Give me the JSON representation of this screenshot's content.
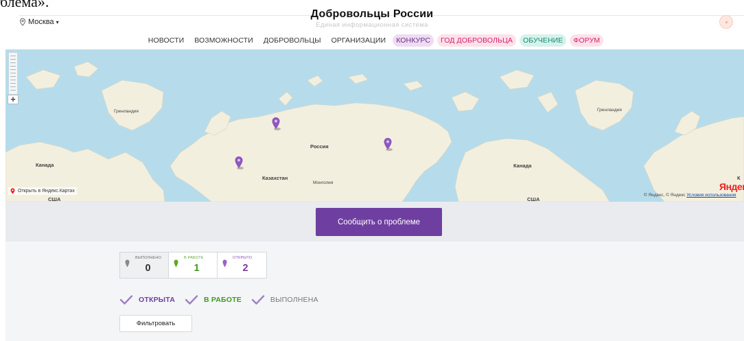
{
  "header": {
    "top_fragment": "блема».",
    "city": "Москва",
    "title": "Добровольцы России",
    "subtitle": "Единая информационная система"
  },
  "nav": {
    "items": [
      {
        "label": "НОВОСТИ"
      },
      {
        "label": "ВОЗМОЖНОСТИ"
      },
      {
        "label": "ДОБРОВОЛЬЦЫ"
      },
      {
        "label": "ОРГАНИЗАЦИИ"
      },
      {
        "label": "КОНКУРС"
      },
      {
        "label": "ГОД ДОБРОВОЛЬЦА"
      },
      {
        "label": "ОБУЧЕНИЕ"
      },
      {
        "label": "ФОРУМ"
      }
    ]
  },
  "map": {
    "labels": {
      "greenland_left": "Гренландия",
      "greenland_right": "Гренландия",
      "russia": "Россия",
      "kazakhstan": "Казахстан",
      "mongolia": "Монголия",
      "canada_left": "Канада",
      "canada_right": "Канада",
      "usa_left": "США",
      "usa_right": "США",
      "k_edge": "К"
    },
    "open_link": "Открыть в Яндекс.Картах",
    "logo": "Яндекс",
    "copyright_prefix": "© Яндекс, © Яндекс",
    "terms": "Условия использования",
    "marker_color": "#8e56c0"
  },
  "report": {
    "button": "Сообщить о проблеме"
  },
  "stats": {
    "done": {
      "label": "ВЫПОЛНЕНО",
      "value": "0"
    },
    "work": {
      "label": "В РАБОТЕ",
      "value": "1"
    },
    "open": {
      "label": "ОТКРЫТО",
      "value": "2"
    }
  },
  "filters": {
    "open": "ОТКРЫТА",
    "work": "В РАБОТЕ",
    "done": "ВЫПОЛНЕНА",
    "button": "Фильтровать"
  },
  "colors": {
    "accent_purple": "#6e3fa0",
    "green": "#3f9a1e",
    "pink": "#d4216a",
    "teal": "#128a6f",
    "sea": "#b6dcec",
    "land": "#f3efdf"
  }
}
